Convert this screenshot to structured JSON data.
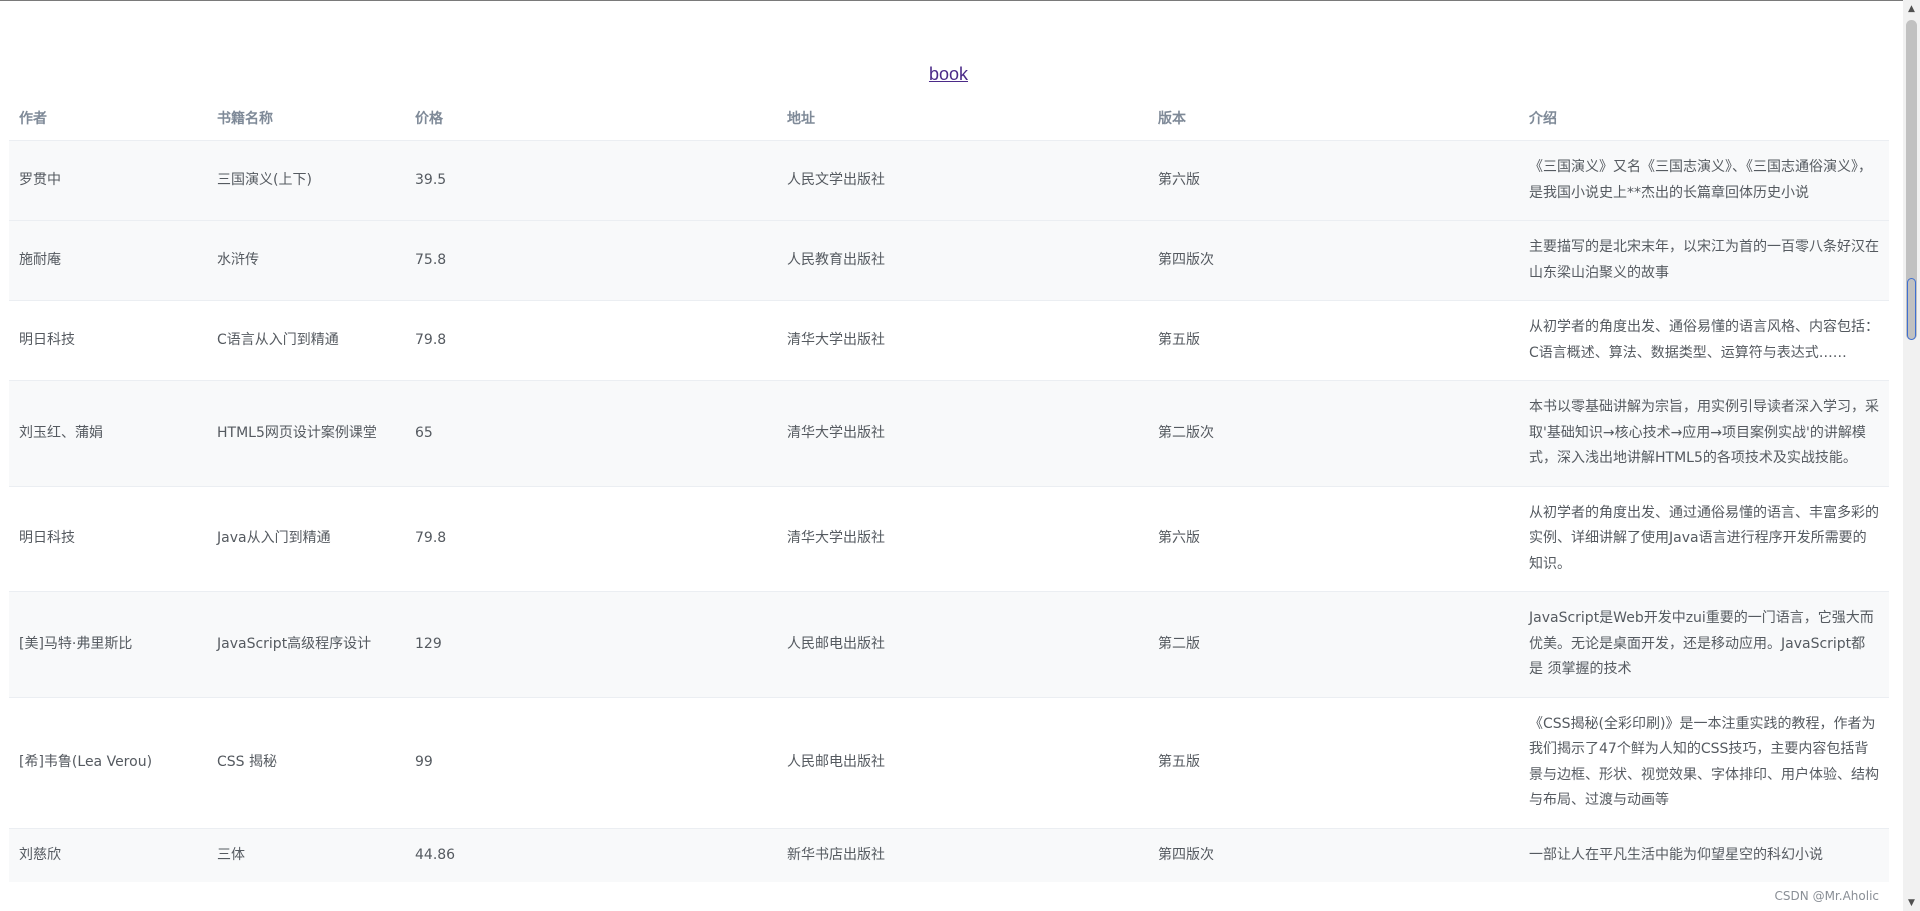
{
  "title": "book",
  "columns": [
    "作者",
    "书籍名称",
    "价格",
    "地址",
    "版本",
    "介绍"
  ],
  "rows": [
    {
      "author": "罗贯中",
      "name": "三国演义(上下)",
      "price": "39.5",
      "address": "人民文学出版社",
      "edition": "第六版",
      "intro": "《三国演义》又名《三国志演义》、《三国志通俗演义》，是我国小说史上**杰出的长篇章回体历史小说"
    },
    {
      "author": "施耐庵",
      "name": "水浒传",
      "price": "75.8",
      "address": "人民教育出版社",
      "edition": "第四版次",
      "intro": "主要描写的是北宋末年，以宋江为首的一百零八条好汉在山东梁山泊聚义的故事"
    },
    {
      "author": "明日科技",
      "name": "C语言从入门到精通",
      "price": "79.8",
      "address": "清华大学出版社",
      "edition": "第五版",
      "intro": "从初学者的角度出发、通俗易懂的语言风格、内容包括：C语言概述、算法、数据类型、运算符与表达式……"
    },
    {
      "author": "刘玉红、蒲娟",
      "name": "HTML5网页设计案例课堂",
      "price": "65",
      "address": "清华大学出版社",
      "edition": "第二版次",
      "intro": "本书以零基础讲解为宗旨，用实例引导读者深入学习，采取'基础知识→核心技术→应用→项目案例实战'的讲解模式，深入浅出地讲解HTML5的各项技术及实战技能。"
    },
    {
      "author": "明日科技",
      "name": "Java从入门到精通",
      "price": "79.8",
      "address": "清华大学出版社",
      "edition": "第六版",
      "intro": "从初学者的角度出发、通过通俗易懂的语言、丰富多彩的实例、详细讲解了使用Java语言进行程序开发所需要的知识。"
    },
    {
      "author": "[美]马特·弗里斯比",
      "name": "JavaScript高级程序设计",
      "price": "129",
      "address": "人民邮电出版社",
      "edition": "第二版",
      "intro": "JavaScript是Web开发中zui重要的一门语言，它强大而优美。无论是桌面开发，还是移动应用。JavaScript都是 须掌握的技术"
    },
    {
      "author": "[希]韦鲁(Lea Verou)",
      "name": "CSS 揭秘",
      "price": "99",
      "address": "人民邮电出版社",
      "edition": "第五版",
      "intro": "《CSS揭秘(全彩印刷)》是一本注重实践的教程，作者为我们揭示了47个鲜为人知的CSS技巧，主要内容包括背景与边框、形状、视觉效果、字体排印、用户体验、结构与布局、过渡与动画等"
    },
    {
      "author": "刘慈欣",
      "name": "三体",
      "price": "44.86",
      "address": "新华书店出版社",
      "edition": "第四版次",
      "intro": "一部让人在平凡生活中能为仰望星空的科幻小说"
    }
  ],
  "watermark": "CSDN @Mr.Aholic",
  "scrollbar": {
    "up_glyph": "▲",
    "down_glyph": "▼"
  }
}
